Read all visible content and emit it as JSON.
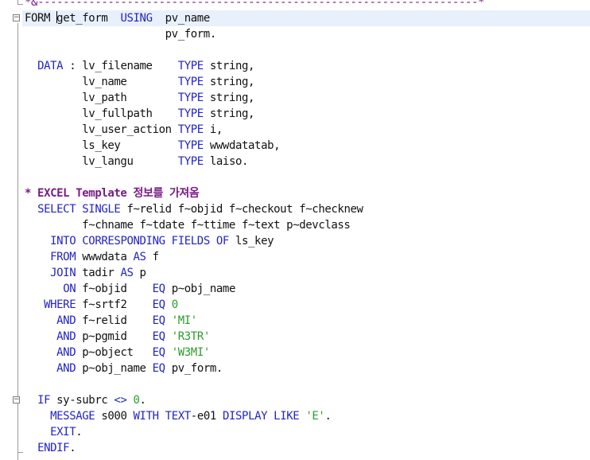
{
  "window": {
    "background": "#ffffff",
    "current_line_highlight": "#e8f0fb"
  },
  "colors": {
    "keyword": "#2323c8",
    "string": "#2b9b2b",
    "comment": "#7a1b86",
    "text": "#111111"
  },
  "lines": [
    [
      {
        "t": "*&",
        "c": "sep"
      },
      {
        "t": "---------------------------------------------------------------------*",
        "c": "sep"
      }
    ],
    [
      {
        "t": "FORM ",
        "c": ""
      },
      {
        "t": "g",
        "c": "",
        "caret": true
      },
      {
        "t": "et_form  ",
        "c": ""
      },
      {
        "t": "USING",
        "c": "k"
      },
      {
        "t": "  pv_name",
        "c": ""
      }
    ],
    [
      {
        "t": "                      pv_form.",
        "c": ""
      }
    ],
    [],
    [
      {
        "t": "  ",
        "c": ""
      },
      {
        "t": "DATA",
        "c": "k"
      },
      {
        "t": " : lv_filename    ",
        "c": ""
      },
      {
        "t": "TYPE",
        "c": "k"
      },
      {
        "t": " string,",
        "c": ""
      }
    ],
    [
      {
        "t": "         lv_name        ",
        "c": ""
      },
      {
        "t": "TYPE",
        "c": "k"
      },
      {
        "t": " string,",
        "c": ""
      }
    ],
    [
      {
        "t": "         lv_path        ",
        "c": ""
      },
      {
        "t": "TYPE",
        "c": "k"
      },
      {
        "t": " string,",
        "c": ""
      }
    ],
    [
      {
        "t": "         lv_fullpath    ",
        "c": ""
      },
      {
        "t": "TYPE",
        "c": "k"
      },
      {
        "t": " string,",
        "c": ""
      }
    ],
    [
      {
        "t": "         lv_user_action ",
        "c": ""
      },
      {
        "t": "TYPE",
        "c": "k"
      },
      {
        "t": " i,",
        "c": ""
      }
    ],
    [
      {
        "t": "         ls_key         ",
        "c": ""
      },
      {
        "t": "TYPE",
        "c": "k"
      },
      {
        "t": " wwwdatatab,",
        "c": ""
      }
    ],
    [
      {
        "t": "         lv_langu       ",
        "c": ""
      },
      {
        "t": "TYPE",
        "c": "k"
      },
      {
        "t": " laiso.",
        "c": ""
      }
    ],
    [],
    [
      {
        "t": "* EXCEL Template 정보를 가져옴",
        "c": "c"
      }
    ],
    [
      {
        "t": "  ",
        "c": ""
      },
      {
        "t": "SELECT SINGLE",
        "c": "k"
      },
      {
        "t": " f~relid f~objid f~checkout f~checknew",
        "c": ""
      }
    ],
    [
      {
        "t": "         f~chname f~tdate f~ttime f~text p~devclass",
        "c": ""
      }
    ],
    [
      {
        "t": "    ",
        "c": ""
      },
      {
        "t": "INTO CORRESPONDING FIELDS OF",
        "c": "k"
      },
      {
        "t": " ls_key",
        "c": ""
      }
    ],
    [
      {
        "t": "    ",
        "c": ""
      },
      {
        "t": "FROM",
        "c": "k"
      },
      {
        "t": " wwwdata ",
        "c": ""
      },
      {
        "t": "AS",
        "c": "k"
      },
      {
        "t": " f",
        "c": ""
      }
    ],
    [
      {
        "t": "    ",
        "c": ""
      },
      {
        "t": "JOIN",
        "c": "k"
      },
      {
        "t": " tadir ",
        "c": ""
      },
      {
        "t": "AS",
        "c": "k"
      },
      {
        "t": " p",
        "c": ""
      }
    ],
    [
      {
        "t": "      ",
        "c": ""
      },
      {
        "t": "ON",
        "c": "k"
      },
      {
        "t": " f~objid    ",
        "c": ""
      },
      {
        "t": "EQ",
        "c": "k"
      },
      {
        "t": " p~obj_name",
        "c": ""
      }
    ],
    [
      {
        "t": "   ",
        "c": ""
      },
      {
        "t": "WHERE",
        "c": "k"
      },
      {
        "t": " f~srtf2    ",
        "c": ""
      },
      {
        "t": "EQ",
        "c": "k"
      },
      {
        "t": " ",
        "c": ""
      },
      {
        "t": "0",
        "c": "n"
      }
    ],
    [
      {
        "t": "     ",
        "c": ""
      },
      {
        "t": "AND",
        "c": "k"
      },
      {
        "t": " f~relid    ",
        "c": ""
      },
      {
        "t": "EQ",
        "c": "k"
      },
      {
        "t": " ",
        "c": ""
      },
      {
        "t": "'MI'",
        "c": "s"
      }
    ],
    [
      {
        "t": "     ",
        "c": ""
      },
      {
        "t": "AND",
        "c": "k"
      },
      {
        "t": " p~pgmid    ",
        "c": ""
      },
      {
        "t": "EQ",
        "c": "k"
      },
      {
        "t": " ",
        "c": ""
      },
      {
        "t": "'R3TR'",
        "c": "s"
      }
    ],
    [
      {
        "t": "     ",
        "c": ""
      },
      {
        "t": "AND",
        "c": "k"
      },
      {
        "t": " p~object   ",
        "c": ""
      },
      {
        "t": "EQ",
        "c": "k"
      },
      {
        "t": " ",
        "c": ""
      },
      {
        "t": "'W3MI'",
        "c": "s"
      }
    ],
    [
      {
        "t": "     ",
        "c": ""
      },
      {
        "t": "AND",
        "c": "k"
      },
      {
        "t": " p~obj_name ",
        "c": ""
      },
      {
        "t": "EQ",
        "c": "k"
      },
      {
        "t": " pv_form.",
        "c": ""
      }
    ],
    [],
    [
      {
        "t": "  ",
        "c": ""
      },
      {
        "t": "IF",
        "c": "k"
      },
      {
        "t": " sy-subrc ",
        "c": ""
      },
      {
        "t": "<>",
        "c": "k"
      },
      {
        "t": " ",
        "c": ""
      },
      {
        "t": "0",
        "c": "n"
      },
      {
        "t": ".",
        "c": ""
      }
    ],
    [
      {
        "t": "    ",
        "c": ""
      },
      {
        "t": "MESSAGE",
        "c": "k"
      },
      {
        "t": " s000 ",
        "c": ""
      },
      {
        "t": "WITH",
        "c": "k"
      },
      {
        "t": " ",
        "c": ""
      },
      {
        "t": "TEXT",
        "c": "k"
      },
      {
        "t": "-e01 ",
        "c": ""
      },
      {
        "t": "DISPLAY LIKE",
        "c": "k"
      },
      {
        "t": " ",
        "c": ""
      },
      {
        "t": "'E'",
        "c": "s"
      },
      {
        "t": ".",
        "c": ""
      }
    ],
    [
      {
        "t": "    ",
        "c": ""
      },
      {
        "t": "EXIT",
        "c": "k"
      },
      {
        "t": ".",
        "c": ""
      }
    ],
    [
      {
        "t": "  ",
        "c": ""
      },
      {
        "t": "ENDIF",
        "c": "k"
      },
      {
        "t": ".",
        "c": ""
      }
    ]
  ],
  "fold_markers": [
    {
      "line": 1,
      "symbol": "−"
    },
    {
      "line": 25,
      "symbol": "−"
    }
  ]
}
